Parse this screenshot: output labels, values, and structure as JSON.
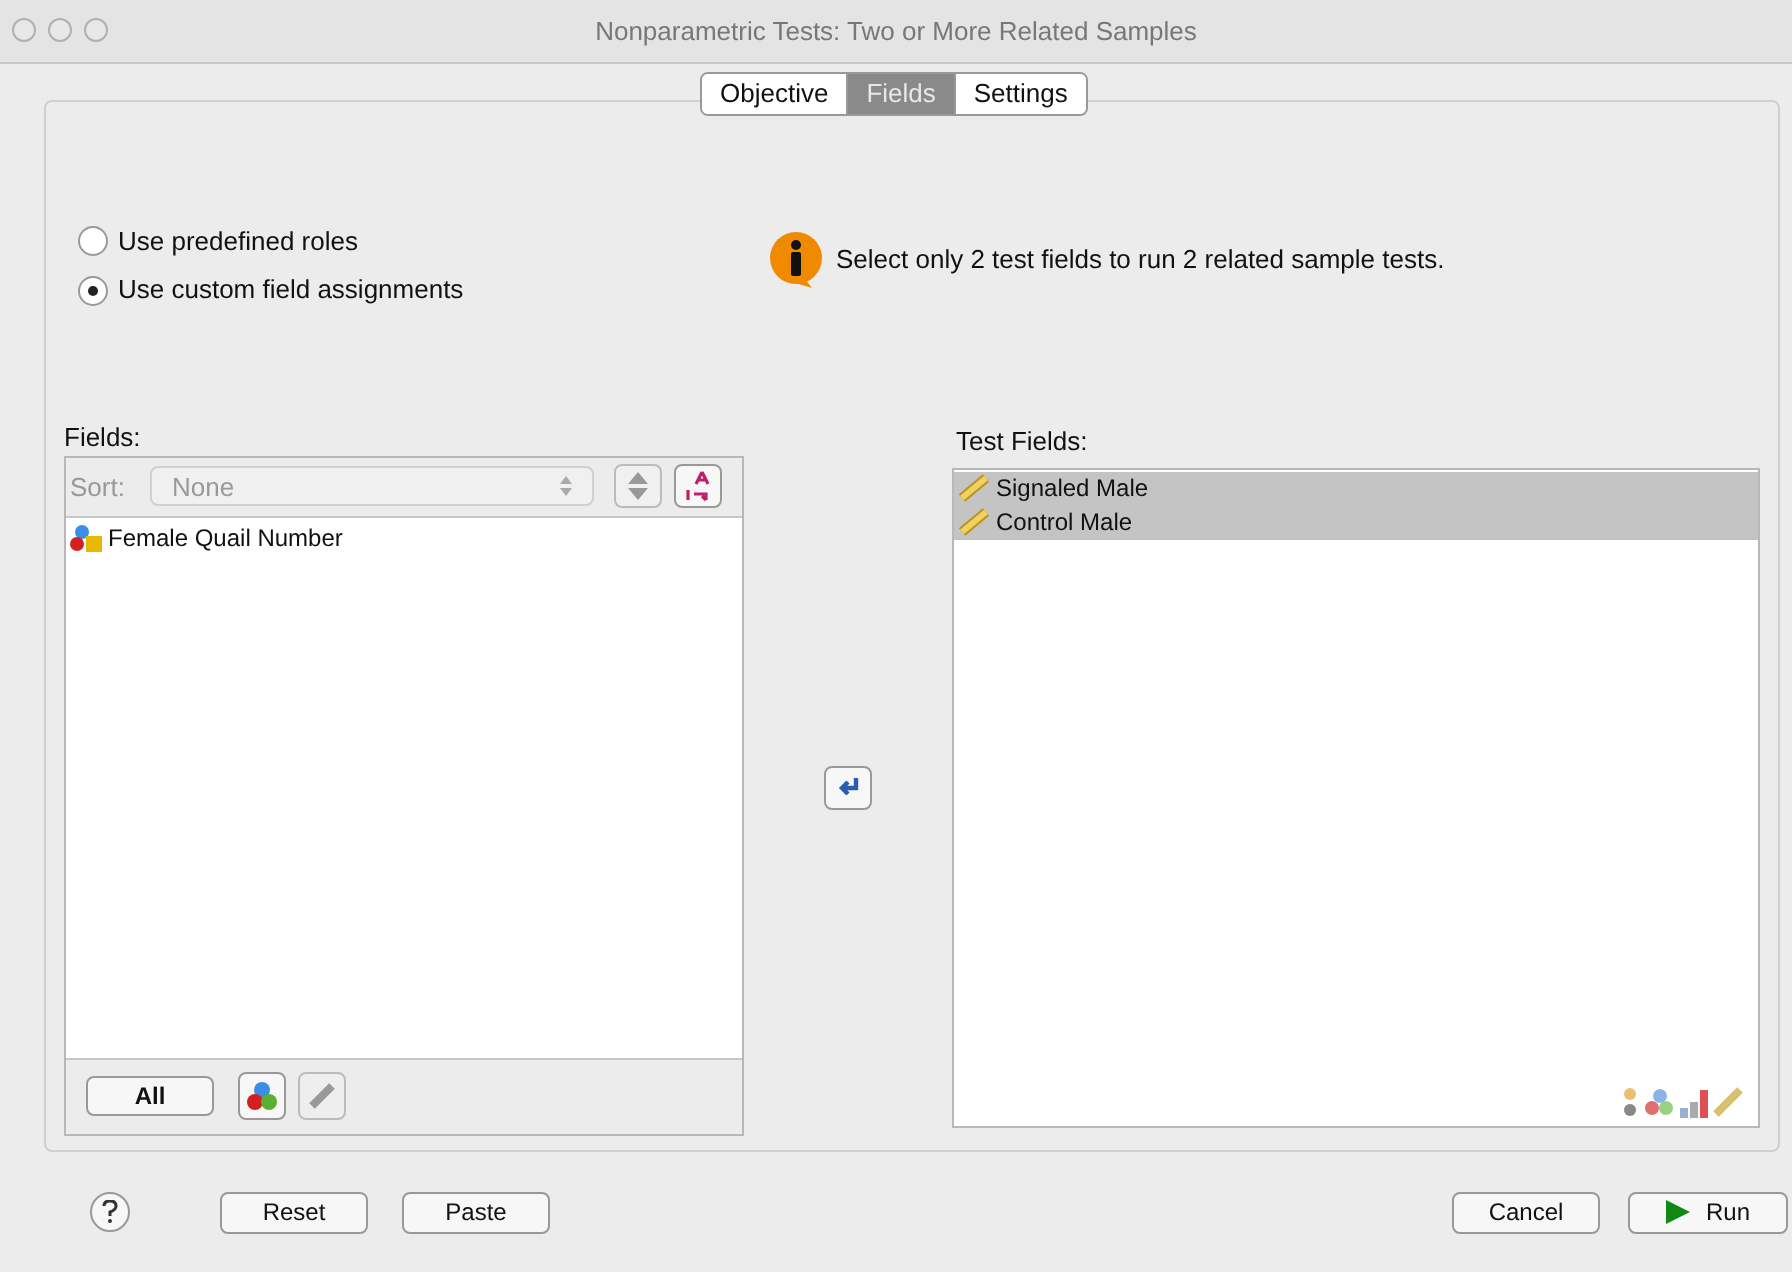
{
  "window": {
    "title": "Nonparametric Tests: Two or More Related Samples"
  },
  "tabs": [
    {
      "label": "Objective",
      "selected": false
    },
    {
      "label": "Fields",
      "selected": true
    },
    {
      "label": "Settings",
      "selected": false
    }
  ],
  "role_options": [
    {
      "label": "Use predefined roles",
      "selected": false
    },
    {
      "label": "Use custom field assignments",
      "selected": true
    }
  ],
  "info_message": "Select only 2 test fields to run 2 related sample tests.",
  "fields_list": {
    "label": "Fields:",
    "sort_label": "Sort:",
    "sort_value": "None",
    "items": [
      {
        "label": "Female Quail Number",
        "kind": "nominal",
        "selected": false
      }
    ],
    "all_button": "All"
  },
  "test_fields": {
    "label": "Test Fields:",
    "items": [
      {
        "label": "Signaled Male",
        "kind": "scale",
        "selected": true
      },
      {
        "label": "Control Male",
        "kind": "scale",
        "selected": true
      }
    ]
  },
  "footer_buttons": [
    {
      "label": "Reset",
      "kind": "plain"
    },
    {
      "label": "Paste",
      "kind": "plain"
    },
    {
      "label": "Cancel",
      "kind": "plain"
    },
    {
      "label": "Run",
      "kind": "run"
    }
  ]
}
